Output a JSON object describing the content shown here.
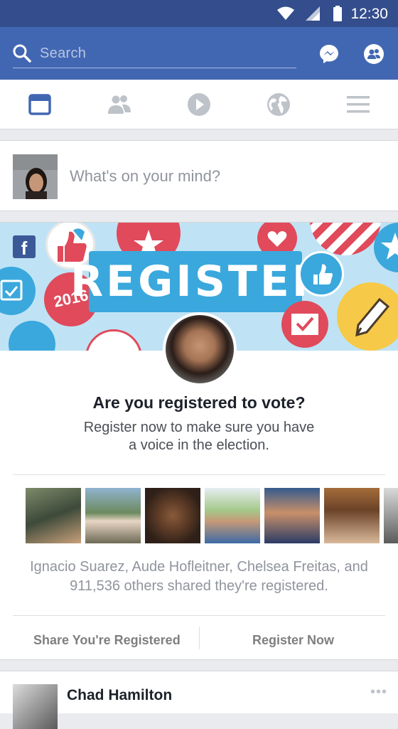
{
  "status_bar": {
    "time": "12:30",
    "icons": [
      "wifi-icon",
      "signal-icon",
      "battery-icon"
    ]
  },
  "top_bar": {
    "search_placeholder": "Search",
    "icons": [
      "search-icon",
      "messenger-icon",
      "friends-icon"
    ]
  },
  "tabs": [
    {
      "name": "news-feed",
      "icon": "news-feed-icon",
      "active": true
    },
    {
      "name": "friends",
      "icon": "friends-icon",
      "active": false
    },
    {
      "name": "video",
      "icon": "play-icon",
      "active": false
    },
    {
      "name": "notifications",
      "icon": "globe-icon",
      "active": false
    },
    {
      "name": "menu",
      "icon": "menu-icon",
      "active": false
    }
  ],
  "composer": {
    "prompt": "What's on your mind?"
  },
  "register_card": {
    "banner_text": "REGISTER",
    "badge_year": "2016",
    "title": "Are you registered to vote?",
    "subtitle_line1": "Register now to make sure you have",
    "subtitle_line2": "a voice in the election.",
    "shared_line1": "Ignacio Suarez, Aude Hofleitner, Chelsea Freitas, and",
    "shared_line2": "911,536 others shared they're registered.",
    "share_action": "Share You're Registered",
    "register_action": "Register Now"
  },
  "next_post": {
    "author": "Chad Hamilton",
    "more": "•••"
  },
  "colors": {
    "brand": "#4267b2",
    "status_bar": "#344d8c",
    "active_tab": "#4267b2",
    "inactive_tab": "#bec3c9"
  }
}
